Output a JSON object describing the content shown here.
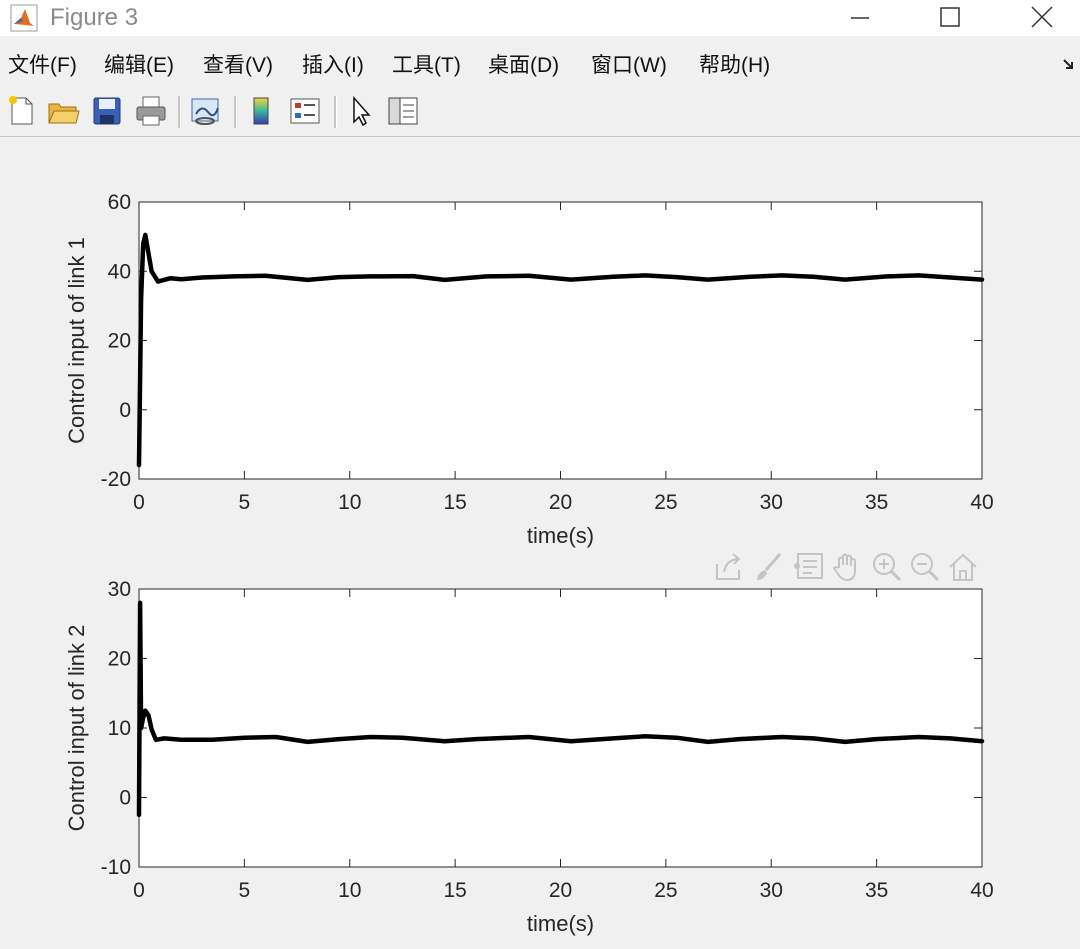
{
  "window": {
    "title": "Figure 3",
    "icon": "matlab-icon",
    "controls": [
      "minimize-icon",
      "maximize-icon",
      "close-icon"
    ]
  },
  "menu": {
    "items": [
      "文件(F)",
      "编辑(E)",
      "查看(V)",
      "插入(I)",
      "工具(T)",
      "桌面(D)",
      "窗口(W)",
      "帮助(H)"
    ]
  },
  "toolbar": {
    "tools": [
      "new-figure-icon",
      "open-file-icon",
      "save-icon",
      "print-icon",
      "link-plot-icon",
      "colorbar-icon",
      "legend-icon",
      "edit-plot-icon",
      "property-inspector-icon"
    ]
  },
  "axes_toolbar": {
    "tools": [
      "export-icon",
      "brush-icon",
      "data-tips-icon",
      "pan-icon",
      "zoom-in-icon",
      "zoom-out-icon",
      "home-icon"
    ]
  },
  "chart_data": [
    {
      "type": "line",
      "xlabel": "time(s)",
      "ylabel": "Control input of link 1",
      "xlim": [
        0,
        40
      ],
      "ylim": [
        -20,
        60
      ],
      "xticks": [
        "0",
        "5",
        "10",
        "15",
        "20",
        "25",
        "30",
        "35",
        "40"
      ],
      "yticks": [
        "-20",
        "0",
        "20",
        "40",
        "60"
      ],
      "line_color": "#000000",
      "x": [
        0,
        0.1,
        0.2,
        0.3,
        0.4,
        0.6,
        0.9,
        1.5,
        2,
        3,
        4.5,
        6,
        8,
        9.5,
        11,
        13,
        14.5,
        16.5,
        18.5,
        20.5,
        22.5,
        24,
        25.5,
        27,
        29,
        30.5,
        32,
        33.5,
        35.5,
        37,
        38.5,
        40
      ],
      "y": [
        -16,
        32,
        48,
        50.5,
        47,
        40,
        37,
        38,
        37.7,
        38.2,
        38.5,
        38.7,
        37.5,
        38.3,
        38.5,
        38.6,
        37.5,
        38.5,
        38.7,
        37.6,
        38.4,
        38.8,
        38.3,
        37.6,
        38.4,
        38.8,
        38.4,
        37.6,
        38.5,
        38.8,
        38.2,
        37.6
      ]
    },
    {
      "type": "line",
      "xlabel": "time(s)",
      "ylabel": "Control input of link 2",
      "xlim": [
        0,
        40
      ],
      "ylim": [
        -10,
        30
      ],
      "xticks": [
        "0",
        "5",
        "10",
        "15",
        "20",
        "25",
        "30",
        "35",
        "40"
      ],
      "yticks": [
        "-10",
        "0",
        "10",
        "20",
        "30"
      ],
      "line_color": "#000000",
      "x": [
        0,
        0.05,
        0.1,
        0.2,
        0.3,
        0.45,
        0.6,
        0.8,
        1.2,
        2,
        3.5,
        5,
        6.5,
        8,
        9.5,
        11,
        12.5,
        14.5,
        16,
        18.5,
        20.5,
        22.5,
        24,
        25.5,
        27,
        28.5,
        30.5,
        32,
        33.5,
        35,
        37,
        38.5,
        40
      ],
      "y": [
        -2.5,
        28,
        10,
        11.5,
        12.5,
        11.8,
        9.8,
        8.3,
        8.5,
        8.3,
        8.3,
        8.6,
        8.7,
        8.0,
        8.4,
        8.7,
        8.6,
        8.1,
        8.4,
        8.7,
        8.1,
        8.5,
        8.8,
        8.6,
        8.0,
        8.4,
        8.7,
        8.5,
        8.0,
        8.4,
        8.7,
        8.5,
        8.1
      ]
    }
  ]
}
